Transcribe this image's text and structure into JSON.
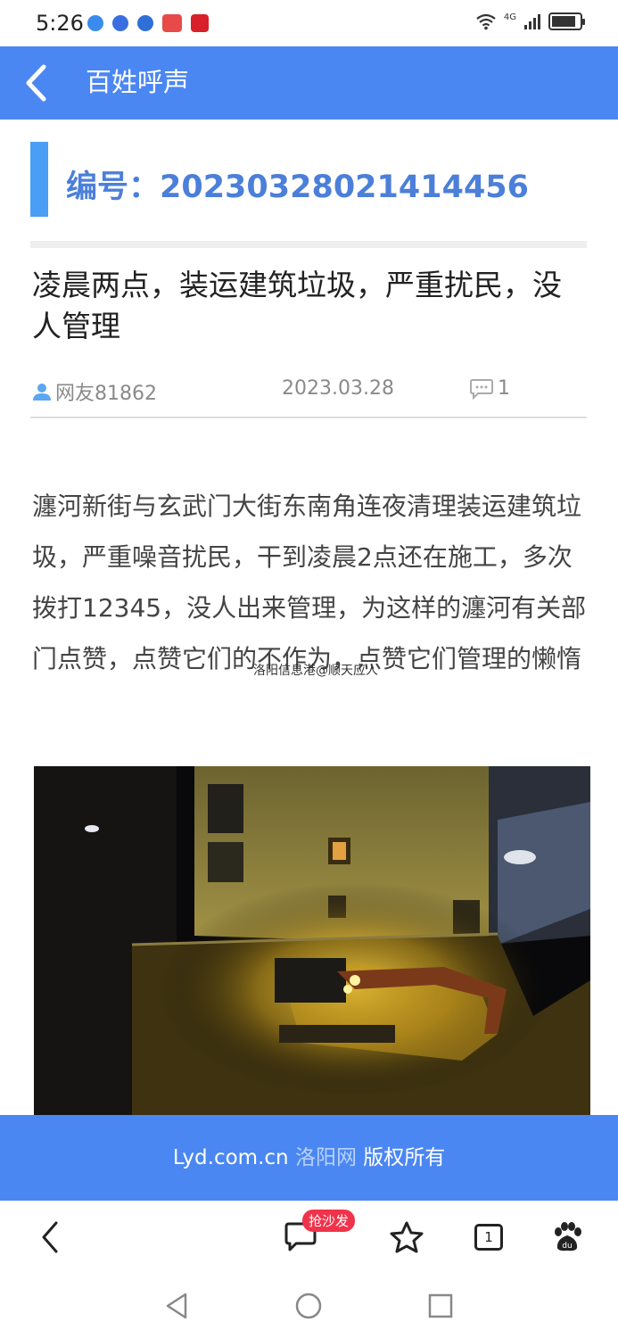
{
  "status_bar": {
    "time": "5:26",
    "network": "4G",
    "app_icons": [
      "shield-app-icon",
      "music-app-icon",
      "browser-app-icon",
      "huawei-app-icon",
      "tmall-app-icon"
    ]
  },
  "header": {
    "title": "百姓呼声"
  },
  "article": {
    "number_label": "编号：20230328021414456",
    "title": "凌晨两点，装运建筑垃圾，严重扰民，没人管理",
    "author": "网友81862",
    "date": "2023.03.28",
    "comment_count": "1",
    "body": "瀍河新街与玄武门大街东南角连夜清理装运建筑垃圾，严重噪音扰民，干到凌晨2点还在施工，多次拨打12345，没人出来管理，为这样的瀍河有关部门点赞，点赞它们的不作为，点赞它们管理的懒惰",
    "watermark": "洛阳信息港@顺天应人"
  },
  "copyright": {
    "domain": "Lyd.com.cn",
    "site_name": "洛阳网",
    "rights": "版权所有"
  },
  "browser_toolbar": {
    "comment_badge": "抢沙发",
    "tab_count": "1"
  },
  "colors": {
    "primary_blue": "#4b87f2",
    "number_text": "#4b7fd9",
    "accent_bar": "#4b9ef5",
    "badge_red": "#f0334a"
  }
}
